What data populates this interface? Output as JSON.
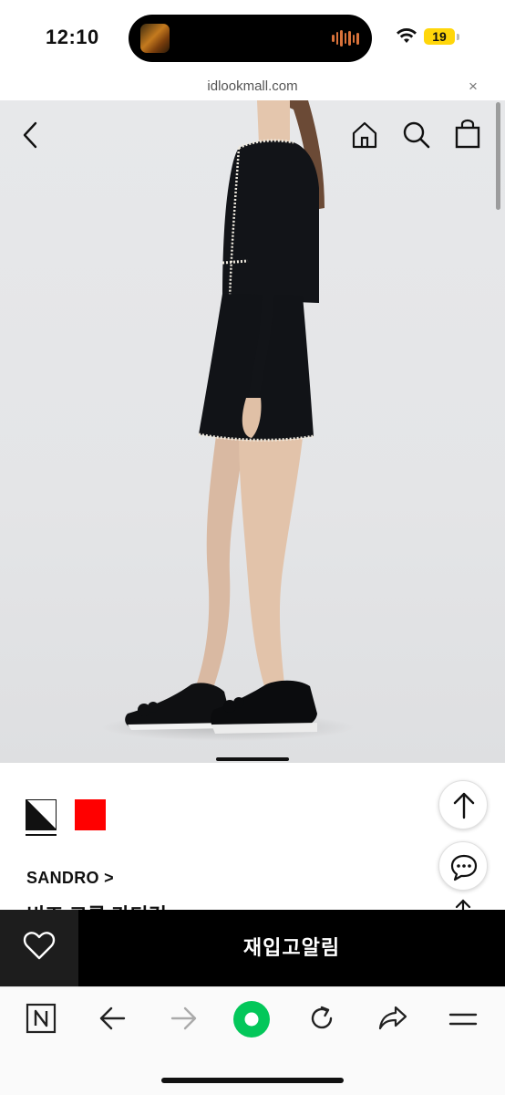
{
  "status_bar": {
    "time": "12:10",
    "battery": "19",
    "icons": [
      "wifi-icon",
      "battery-icon",
      "audio-wave-icon"
    ]
  },
  "browser": {
    "url": "idlookmall.com",
    "close_symbol": "×"
  },
  "header_nav": {
    "icons": [
      "back-arrow-icon",
      "home-icon",
      "search-icon",
      "shopping-bag-icon"
    ]
  },
  "product": {
    "color_swatches": [
      {
        "name": "black",
        "color": "#111111",
        "selected": true
      },
      {
        "name": "red",
        "color": "#ff0000",
        "selected": false
      }
    ],
    "brand": "SANDRO >",
    "title": "비즈 크롭 가디건"
  },
  "floating_buttons": {
    "icons": [
      "scroll-top-icon",
      "chat-bubble-icon"
    ]
  },
  "action_bar": {
    "restock_label": "재입고알림",
    "wishlist_icon": "heart-icon"
  },
  "toolbar": {
    "icons": [
      "naver-icon",
      "back-icon",
      "forward-icon",
      "green-dot-icon",
      "refresh-icon",
      "share-icon",
      "menu-icon"
    ],
    "accent": "#03c75a"
  }
}
